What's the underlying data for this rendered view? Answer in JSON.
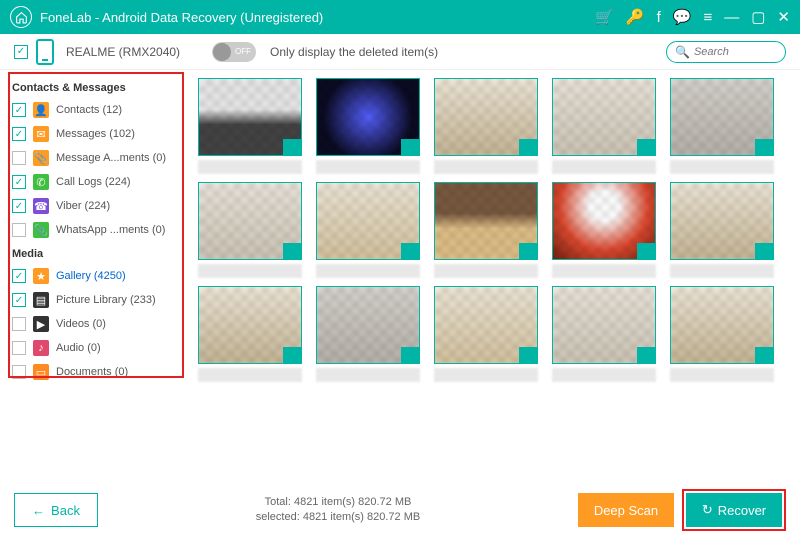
{
  "titlebar": {
    "title": "FoneLab - Android Data Recovery (Unregistered)"
  },
  "toolbar": {
    "device": "REALME (RMX2040)",
    "only_deleted_label": "Only display the deleted item(s)",
    "toggle_state": "OFF",
    "search_placeholder": "Search"
  },
  "sidebar": {
    "group_contacts": "Contacts & Messages",
    "group_media": "Media",
    "items": [
      {
        "label": "Contacts (12)",
        "checked": true,
        "icon_bg": "#ff9a22",
        "icon": "👤"
      },
      {
        "label": "Messages (102)",
        "checked": true,
        "icon_bg": "#ff9a22",
        "icon": "✉"
      },
      {
        "label": "Message A...ments (0)",
        "checked": false,
        "icon_bg": "#ff9a22",
        "icon": "📎"
      },
      {
        "label": "Call Logs (224)",
        "checked": true,
        "icon_bg": "#3fbf3f",
        "icon": "✆"
      },
      {
        "label": "Viber (224)",
        "checked": true,
        "icon_bg": "#7b4fd8",
        "icon": "☎"
      },
      {
        "label": "WhatsApp ...ments (0)",
        "checked": false,
        "icon_bg": "#3fbf3f",
        "icon": "📎"
      },
      {
        "label": "Gallery (4250)",
        "checked": true,
        "icon_bg": "#ff9a22",
        "icon": "★",
        "selected": true
      },
      {
        "label": "Picture Library (233)",
        "checked": true,
        "icon_bg": "#333333",
        "icon": "▤"
      },
      {
        "label": "Videos (0)",
        "checked": false,
        "icon_bg": "#333333",
        "icon": "▶"
      },
      {
        "label": "Audio (0)",
        "checked": false,
        "icon_bg": "#e0486c",
        "icon": "♪"
      },
      {
        "label": "Documents (0)",
        "checked": false,
        "icon_bg": "#ff8a22",
        "icon": "▭"
      }
    ]
  },
  "footer": {
    "back": "Back",
    "total_line": "Total: 4821 item(s) 820.72 MB",
    "selected_line": "selected: 4821 item(s) 820.72 MB",
    "deep_scan": "Deep Scan",
    "recover": "Recover"
  }
}
